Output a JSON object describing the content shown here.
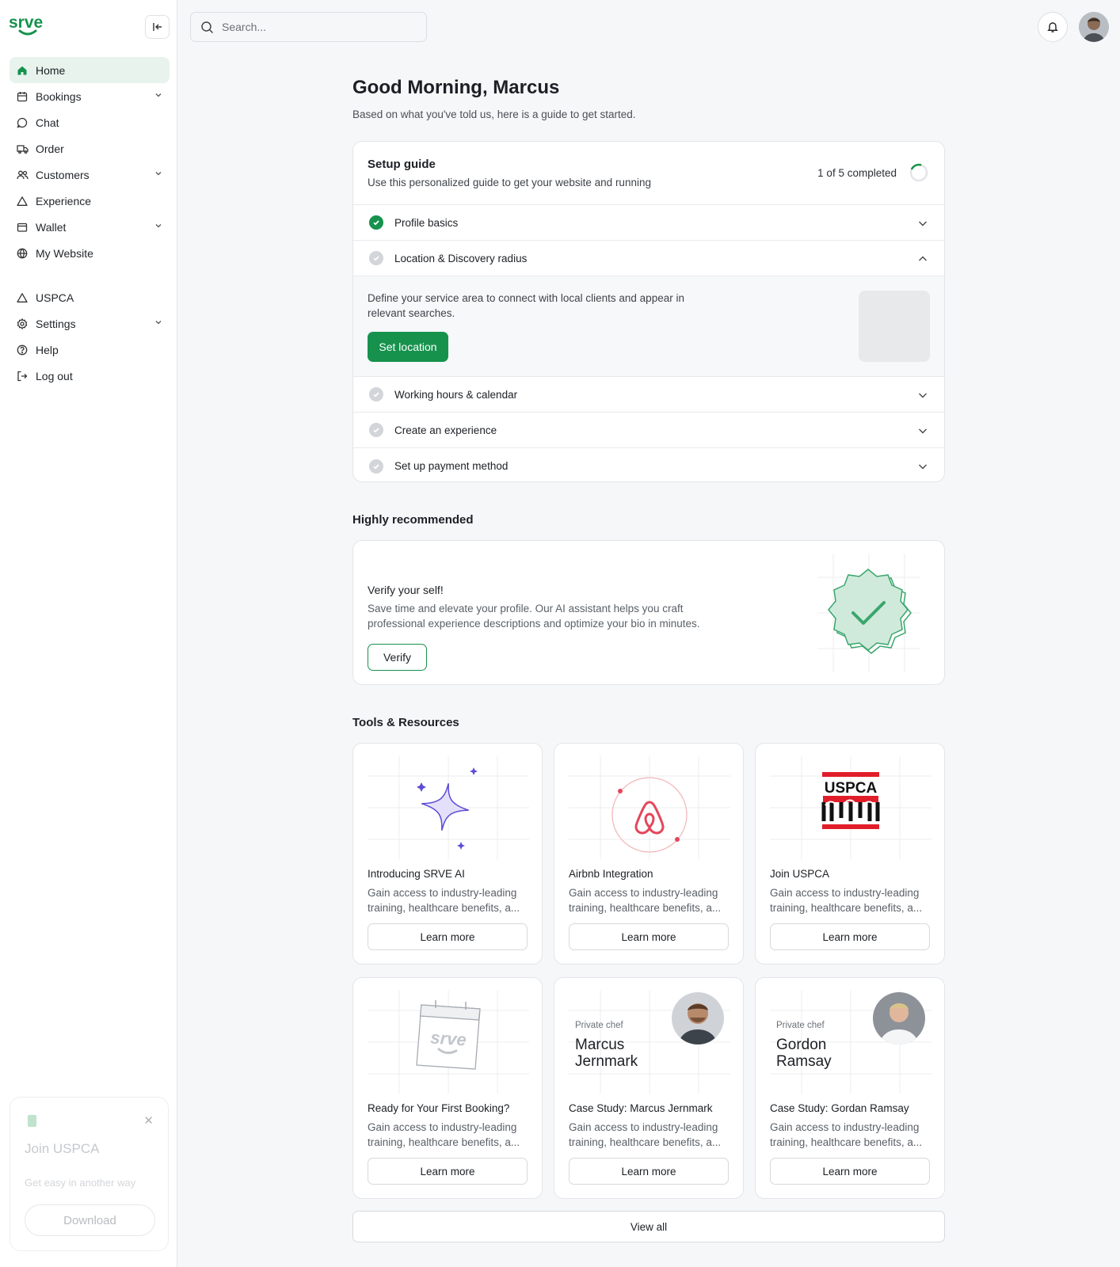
{
  "brand": {
    "name": "srve",
    "accent": "#16924d",
    "accent_light": "#e7f3ec"
  },
  "sidebar": {
    "items": [
      {
        "label": "Home",
        "icon": "home-icon",
        "active": true,
        "expandable": false
      },
      {
        "label": "Bookings",
        "icon": "calendar-icon",
        "expandable": true
      },
      {
        "label": "Chat",
        "icon": "chat-icon",
        "expandable": false
      },
      {
        "label": "Order",
        "icon": "truck-icon",
        "expandable": false
      },
      {
        "label": "Customers",
        "icon": "users-icon",
        "expandable": true
      },
      {
        "label": "Experience",
        "icon": "triangle-icon",
        "expandable": false
      },
      {
        "label": "Wallet",
        "icon": "wallet-icon",
        "expandable": true
      },
      {
        "label": "My Website",
        "icon": "globe-icon",
        "expandable": false
      }
    ],
    "items2": [
      {
        "label": "USPCA",
        "icon": "triangle-icon",
        "expandable": false
      },
      {
        "label": "Settings",
        "icon": "gear-icon",
        "expandable": true
      },
      {
        "label": "Help",
        "icon": "help-icon",
        "expandable": false
      },
      {
        "label": "Log out",
        "icon": "logout-icon",
        "expandable": false
      }
    ],
    "promo": {
      "title": "Join USPCA",
      "subtitle": "Get easy in another way",
      "button": "Download"
    }
  },
  "header": {
    "search_placeholder": "Search..."
  },
  "main": {
    "greeting": "Good Morning, Marcus",
    "subtitle": "Based on what you've told us, here is a guide to get started.",
    "setup": {
      "title": "Setup guide",
      "subtitle": "Use this personalized guide to get your website and running",
      "progress_text": "1 of 5 completed",
      "progress": 0.2,
      "steps": [
        {
          "label": "Profile basics",
          "done": true
        },
        {
          "label": "Location & Discovery radius",
          "done": false,
          "expanded": true,
          "description": "Define your service area to connect with local clients and appear in relevant searches.",
          "button": "Set location"
        },
        {
          "label": "Working hours & calendar",
          "done": false
        },
        {
          "label": "Create an experience",
          "done": false
        },
        {
          "label": "Set up payment method",
          "done": false
        }
      ]
    },
    "recommended": {
      "section_title": "Highly recommended",
      "title": "Verify your self!",
      "description": "Save time and elevate your profile. Our AI assistant helps you craft professional experience descriptions and optimize your bio in minutes.",
      "button": "Verify"
    },
    "tools": {
      "section_title": "Tools & Resources",
      "cards": [
        {
          "title": "Introducing SRVE AI",
          "description": "Gain access to industry-leading training, healthcare benefits, a...",
          "button": "Learn more",
          "art": "sparkle-icon"
        },
        {
          "title": "Airbnb Integration",
          "description": "Gain access to industry-leading training, healthcare benefits, a...",
          "button": "Learn more",
          "art": "airbnb-logo"
        },
        {
          "title": "Join USPCA",
          "description": "Gain access to industry-leading training, healthcare benefits, a...",
          "button": "Learn more",
          "art": "uspca-logo",
          "logo_text": "USPCA"
        },
        {
          "title": "Ready for Your First Booking?",
          "description": "Gain access to industry-leading training, healthcare benefits, a...",
          "button": "Learn more",
          "art": "calendar-srve-icon",
          "logo_text": "srve"
        },
        {
          "title": "Case Study: Marcus Jernmark",
          "description": "Gain access to industry-leading training, healthcare benefits, a...",
          "button": "Learn more",
          "art": "chef-photo",
          "role": "Private chef",
          "name": "Marcus Jernmark"
        },
        {
          "title": "Case Study: Gordan Ramsay",
          "description": "Gain access to industry-leading training, healthcare benefits, a...",
          "button": "Learn more",
          "art": "chef-photo",
          "role": "Private chef",
          "name": "Gordon Ramsay"
        }
      ],
      "view_all": "View all"
    }
  }
}
